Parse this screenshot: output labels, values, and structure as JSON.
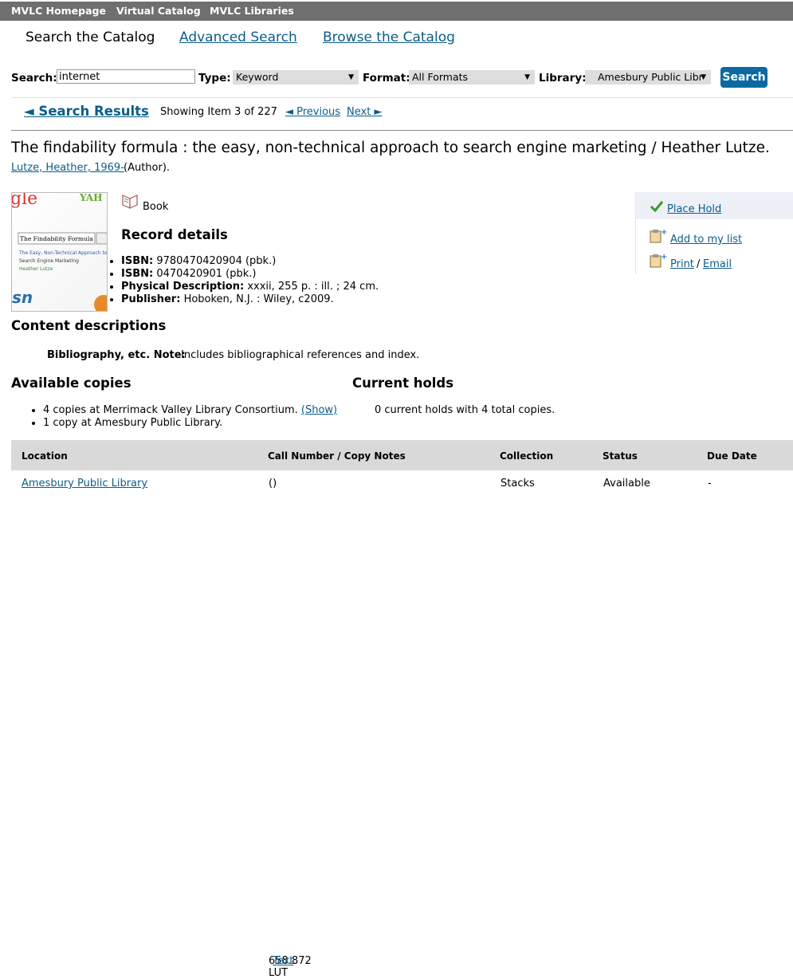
{
  "topnav": [
    "MVLC Homepage",
    "Virtual Catalog",
    "MVLC Libraries"
  ],
  "tabs": {
    "current": "Search the Catalog",
    "advanced": "Advanced Search",
    "browse": "Browse the Catalog"
  },
  "search": {
    "search_label": "Search:",
    "query": "internet",
    "type_label": "Type:",
    "type_value": "Keyword",
    "format_label": "Format:",
    "format_value": "All Formats",
    "library_label": "Library:",
    "library_value": "Amesbury Public Libr",
    "button": "Search"
  },
  "results_nav": {
    "back": "◄ Search Results",
    "showing": "Showing Item 3 of 227",
    "previous": "◄ Previous",
    "next": "Next ►"
  },
  "record": {
    "title": "The findability formula : the easy, non-technical approach to search engine marketing / Heather Lutze.",
    "author_link": "Lutze, Heather, 1969-",
    "author_role": "(Author).",
    "format": "Book",
    "details_heading": "Record details",
    "details": [
      {
        "label": "ISBN:",
        "value": "9780470420904 (pbk.)"
      },
      {
        "label": "ISBN:",
        "value": "0470420901 (pbk.)"
      },
      {
        "label": "Physical Description:",
        "value": "xxxii, 255 p. : ill. ; 24 cm."
      },
      {
        "label": "Publisher:",
        "value": "Hoboken, N.J. : Wiley, c2009."
      }
    ],
    "cover": {
      "line1": "The Findability Formula",
      "line2": "The Easy, Non-Technical Approach to",
      "line3": "Search Engine Marketing",
      "line4": "Heather Lutze"
    }
  },
  "actions": {
    "place_hold": "Place Hold",
    "add_list": "Add to my list",
    "print": "Print",
    "sep": "/",
    "email": "Email"
  },
  "content": {
    "heading": "Content descriptions",
    "note_label": "Bibliography, etc. Note:",
    "note_value": "Includes bibliographical references and index."
  },
  "copies": {
    "heading": "Available copies",
    "line1": "4 copies at Merrimack Valley Library Consortium.",
    "show": "(Show)",
    "line2": "1 copy at Amesbury Public Library."
  },
  "holds": {
    "heading": "Current holds",
    "text": "0 current holds with 4 total copies."
  },
  "table": {
    "headers": [
      "Location",
      "Call Number / Copy Notes",
      "Collection",
      "Status",
      "Due Date"
    ],
    "row": {
      "location": "Amesbury Public Library",
      "call": "658.872 LUT",
      "text_link": "Text",
      "collection": "Stacks",
      "status": "Available",
      "due": "-"
    }
  },
  "colors": {
    "link": "#0b5d8a",
    "button": "#0b6aa2",
    "topbar": "#6f6f6f",
    "check": "#3a9a2a"
  }
}
